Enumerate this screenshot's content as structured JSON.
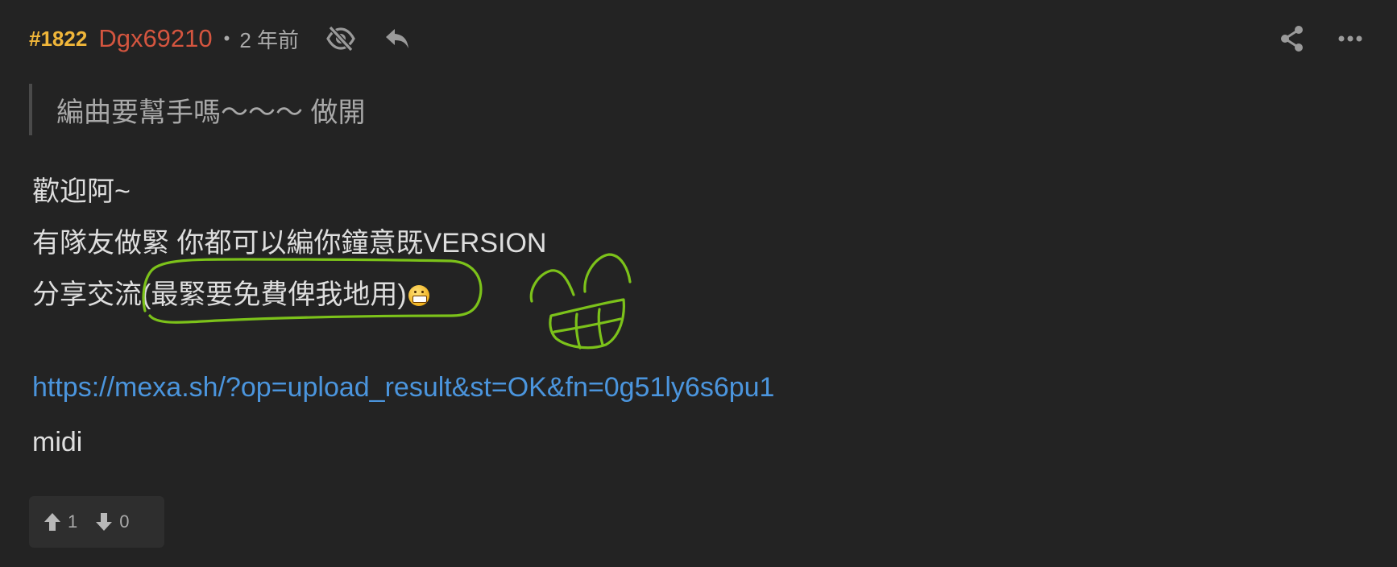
{
  "post": {
    "id": "#1822",
    "username": "Dgx69210",
    "separator": "•",
    "time": "2 年前"
  },
  "quote": {
    "text": "編曲要幫手嗎～～～ 做開"
  },
  "body": {
    "line1": "歡迎阿~",
    "line2": "有隊友做緊 你都可以編你鐘意既VERSION",
    "line3_prefix": "分享交流",
    "line3_highlight": "(最緊要免費俾我地用)",
    "link": "https://mexa.sh/?op=upload_result&st=OK&fn=0g51ly6s6pu1",
    "midi": "midi"
  },
  "votes": {
    "up": "1",
    "down": "0"
  },
  "icons": {
    "hide": "eye-slash-icon",
    "reply": "reply-icon",
    "share": "share-icon",
    "more": "more-dots-icon",
    "emoji": "grin-emoji-icon",
    "upvote": "arrow-up-icon",
    "downvote": "arrow-down-icon"
  },
  "colors": {
    "post_id": "#f0b63a",
    "username": "#d4553f",
    "link": "#4b95dd",
    "annotation": "#7cc21a",
    "background": "#232323"
  }
}
